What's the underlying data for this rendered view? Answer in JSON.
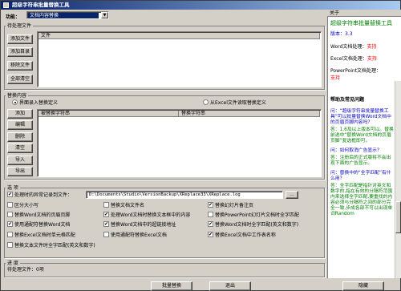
{
  "window": {
    "title": "超级字符串批量替换工具"
  },
  "function": {
    "label": "功能：",
    "value": "文档内容替换"
  },
  "files": {
    "group_label": "待处理文件",
    "column": "文件",
    "buttons": [
      "添加文件",
      "添加目录",
      "移除文件",
      "全部清空"
    ]
  },
  "replace": {
    "group_label": "替换内容",
    "radio_interface": "界面录入替换定义",
    "radio_excel": "从Excel文件读取替换定义",
    "col_find": "被替换字符串",
    "col_replace": "替换字符串",
    "buttons": [
      "添加",
      "编辑",
      "删除",
      "清空",
      "导入",
      "导出"
    ]
  },
  "options": {
    "group_label": "选 项",
    "log_label": "处理时的异常记录到文件：",
    "log_path": "D:\\Documents\\Studio\\VersionBackup\\XReplace33\\XReplace.log",
    "browse": "...",
    "checks": [
      {
        "label": "区分大小写",
        "checked": false
      },
      {
        "label": "替换文档文件名",
        "checked": false
      },
      {
        "label": "替换幻灯片备注页",
        "checked": true
      },
      {
        "label": "替换Word文档的页眉页脚",
        "checked": false
      },
      {
        "label": "处理Word文档时替换文本框中的内容",
        "checked": true
      },
      {
        "label": "替换PowerPoint幻灯片文档时全字匹配",
        "checked": false
      },
      {
        "label": "使用通配符替换Word文档",
        "checked": true
      },
      {
        "label": "替换Word文档中的超链接地址",
        "checked": true
      },
      {
        "label": "替换Word文档时全字匹配(英文和数字)",
        "checked": true
      },
      {
        "label": "替换Excel文档时单元格匹配",
        "checked": false
      },
      {
        "label": "使用通配符替换Excel文档",
        "checked": false
      },
      {
        "label": "替换Excel文档中工作表名称",
        "checked": true
      },
      {
        "label": "替换文本文件时全字匹配(英文和数字)",
        "checked": false
      }
    ]
  },
  "progress": {
    "group_label": "进 度",
    "status": "待处理文件：0项"
  },
  "actions": {
    "run": "批量替换",
    "exit": "退出",
    "hide": "隐藏"
  },
  "about": {
    "header": "关于",
    "title": "超级字符串批量替换工具",
    "version": "版本：3.3",
    "word": "Word文档处理：",
    "word_status": "支持",
    "excel": "Excel文档处理：",
    "excel_status": "支持",
    "ppt": "PowerPoint文档处理：",
    "ppt_status": "支持"
  },
  "faq": {
    "title": "帮助及常见问题",
    "q1": "问：“超级字符串批量替换工具”可以批量替换Word文档中的页眉页脚内容吗？",
    "a1": "答：1.6及以上版本可以。替换前选中“替换Word文档的页眉页脚”复选框即可。",
    "q2": "问：如何取消广告显示？",
    "a2": "答：注册后的正式版将不会出现下面的广告显示。",
    "q3": "问：替换中的“全字匹配”有什么用？",
    "a3": "答：全字匹配是指针对英文和数字的,指在有效的分隔符范围内来选择全字匹配,要重找的内容必须与分隔符之间的部分完全一致,步成各部不可以出现单词Random"
  },
  "colors": {
    "title_start": "#0a246a",
    "accent": "#008000",
    "faq_link": "#0000c0",
    "status": "#ff0000"
  }
}
